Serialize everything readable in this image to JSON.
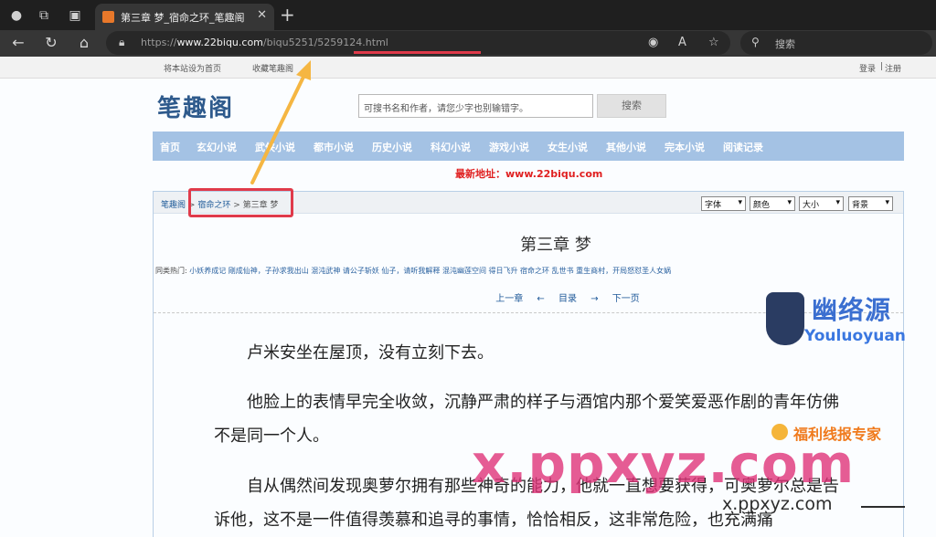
{
  "browser": {
    "tab_title": "第三章 梦_宿命之环_笔趣阁",
    "url_prefix": "https://",
    "url_host": "www.22biqu.com",
    "url_path": "/biqu5251/5259124.html",
    "search_placeholder": "搜索"
  },
  "site": {
    "topbar": {
      "set_home": "将本站设为首页",
      "bookmark": "收藏笔趣阁",
      "login": "登录",
      "sep": "|",
      "register": "注册"
    },
    "logo": "笔趣阁",
    "search": {
      "placeholder": "可搜书名和作者，请您少字也别输错字。",
      "button": "搜索"
    },
    "nav": [
      "首页",
      "玄幻小说",
      "武侠小说",
      "都市小说",
      "历史小说",
      "科幻小说",
      "游戏小说",
      "女生小说",
      "其他小说",
      "完本小说",
      "阅读记录"
    ],
    "latest_address": "最新地址：www.22biqu.com"
  },
  "reader": {
    "breadcrumb": {
      "site": "笔趣阁",
      "book": "宿命之环",
      "chapter": "第三章 梦",
      "sep": ">"
    },
    "settings": [
      "字体",
      "颜色",
      "大小",
      "背景"
    ],
    "chapter_title": "第三章  梦",
    "hot_label": "同类热门:",
    "hot_links": "小妖养成记 剛成仙神，子孙求我出山 混沌武神 请公子斩妖 仙子，请听我解释 混沌幽莲空间 得日飞升 宿命之环 乱世书 重生商村，开局怒怼圣人女娲",
    "prev": "上一章",
    "arrow_left": "←",
    "toc": "目录",
    "arrow_right": "→",
    "next": "下一页",
    "paragraphs": [
      "卢米安坐在屋顶，没有立刻下去。",
      "他脸上的表情早完全收敛，沉静严肃的样子与酒馆内那个爱笑爱恶作剧的青年仿佛不是同一个人。",
      "自从偶然间发现奥萝尔拥有那些神奇的能力，他就一直想要获得，可奥萝尔总是告诉他，这不是一件值得羡慕和追寻的事情，恰恰相反，这非常危险，也充满痛"
    ]
  },
  "watermarks": {
    "youluo_title": "幽络源",
    "youluo_sub": "Youluoyuan",
    "fuli": "福利线报专家",
    "ppxyz": "x.ppxyz.com",
    "ppxyz_small": "x.ppxyz.com"
  },
  "colors": {
    "nav_bg": "#a4c2e4",
    "highlight": "#e03a4a",
    "arrow": "#f5b642"
  }
}
